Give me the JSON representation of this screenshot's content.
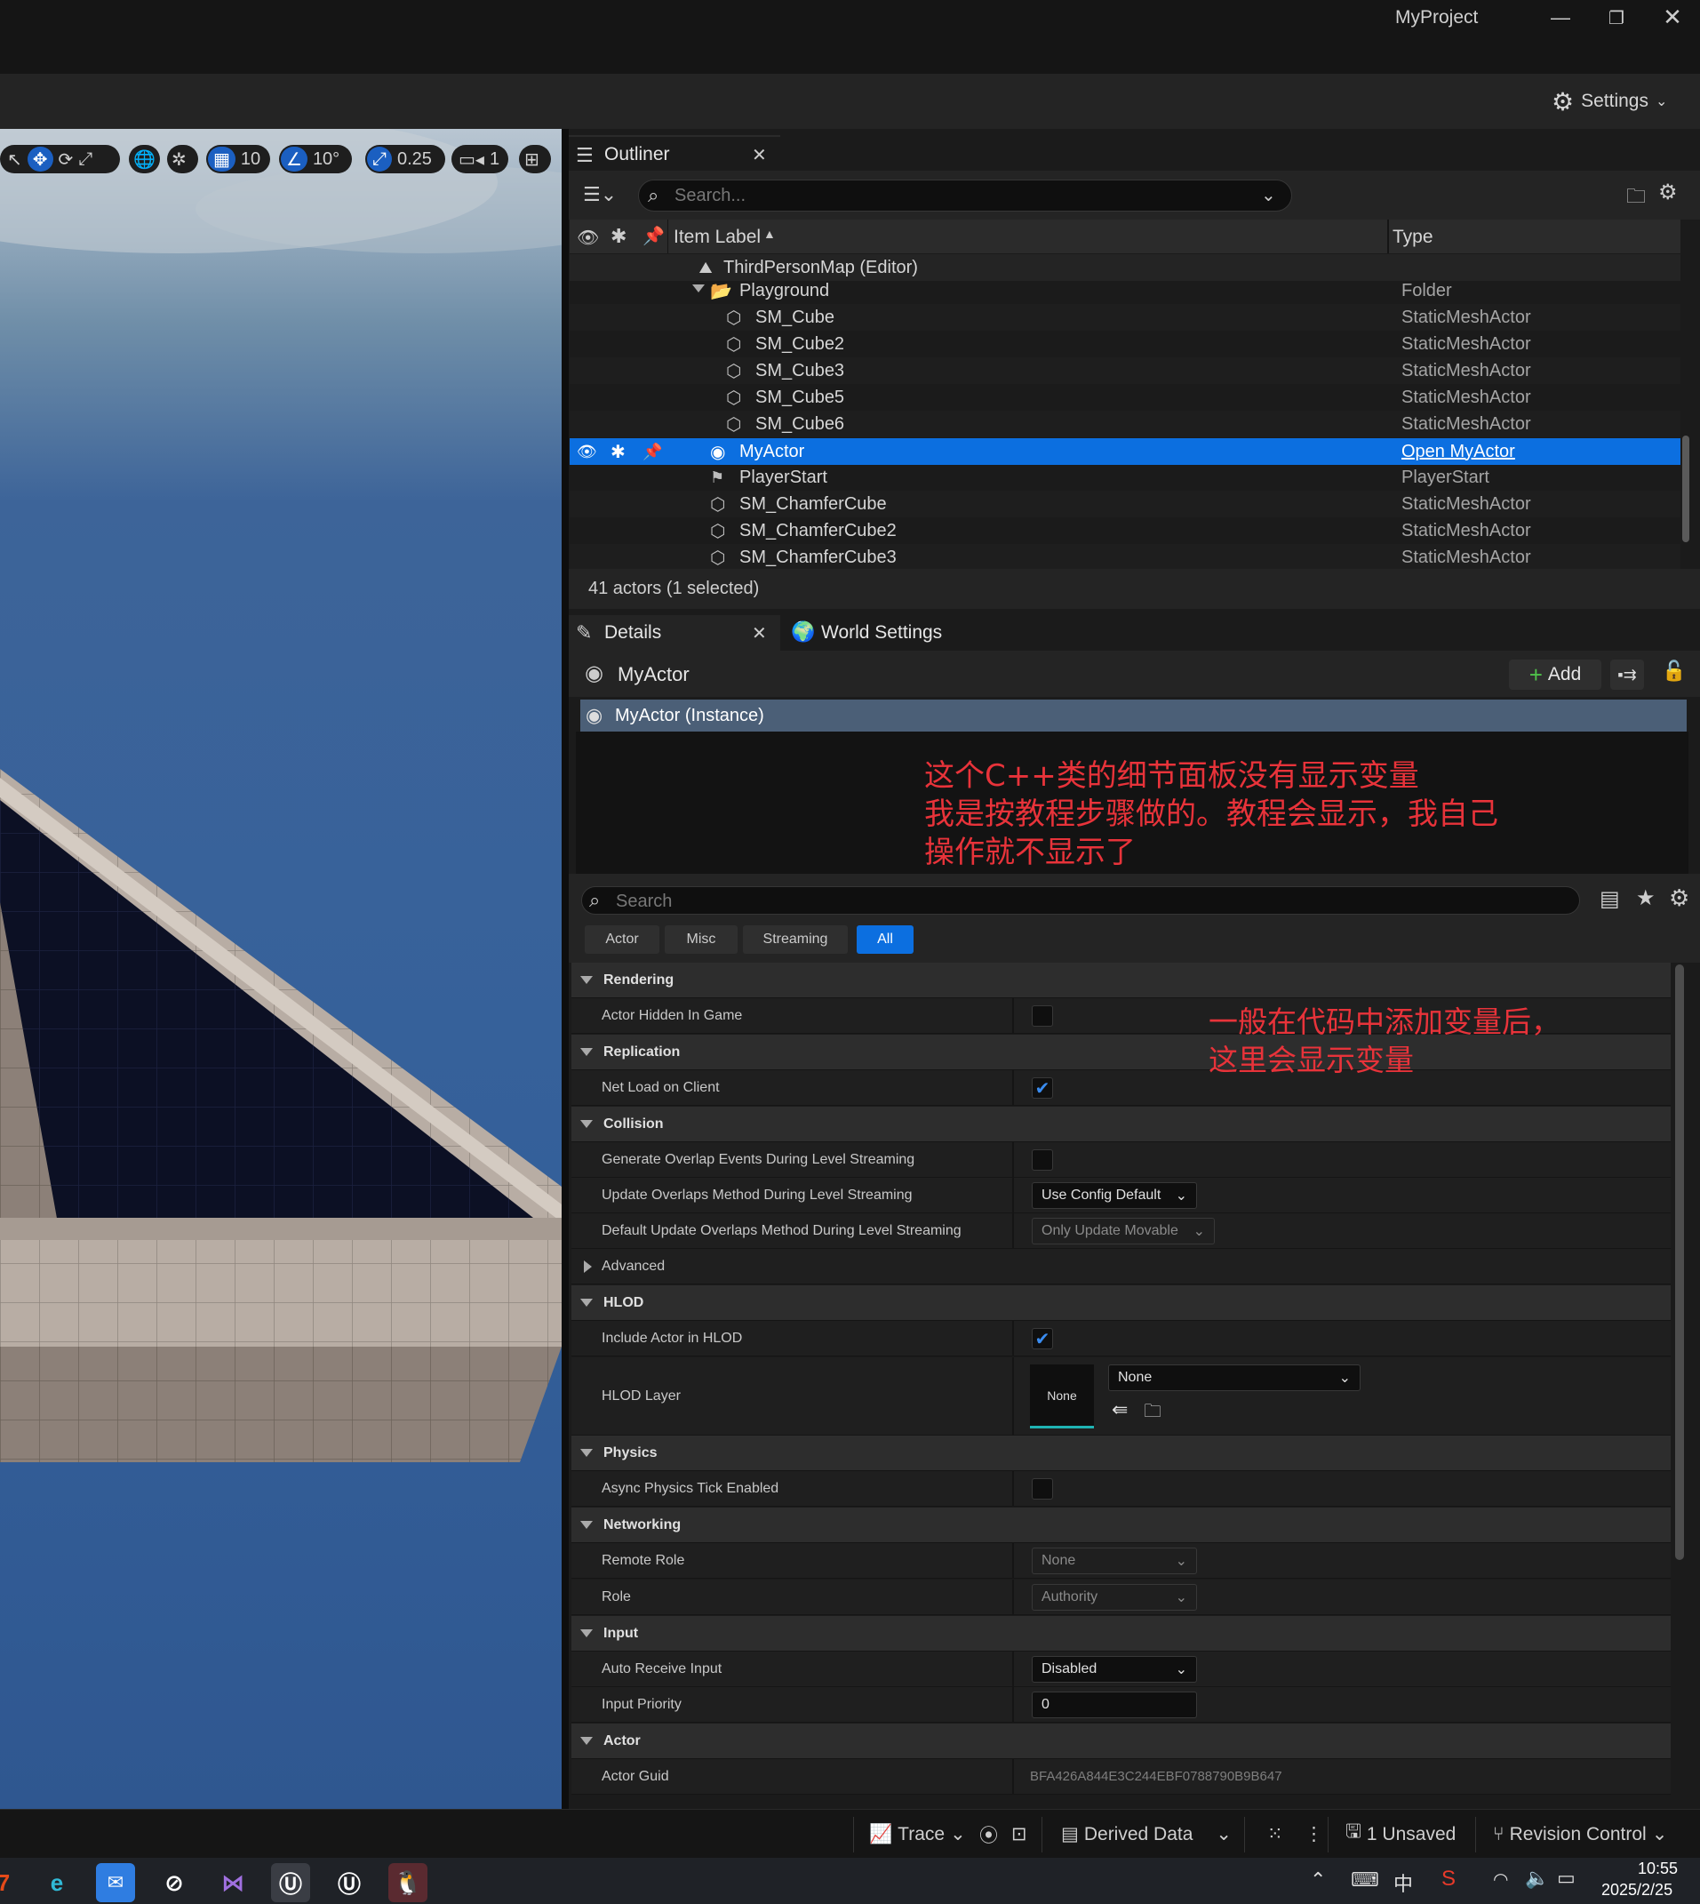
{
  "window": {
    "title": "MyProject",
    "settings_label": "Settings"
  },
  "viewport_toolbar": {
    "grid_snap": "10",
    "rot_snap": "10°",
    "scale_snap": "0.25",
    "camera_speed": "1"
  },
  "outliner": {
    "tab_label": "Outliner",
    "search_placeholder": "Search...",
    "col_label": "Item Label",
    "col_type": "Type",
    "rows": [
      {
        "label": "ThirdPersonMap (Editor)",
        "type": ""
      },
      {
        "label": "Playground",
        "type": "Folder"
      },
      {
        "label": "SM_Cube",
        "type": "StaticMeshActor"
      },
      {
        "label": "SM_Cube2",
        "type": "StaticMeshActor"
      },
      {
        "label": "SM_Cube3",
        "type": "StaticMeshActor"
      },
      {
        "label": "SM_Cube5",
        "type": "StaticMeshActor"
      },
      {
        "label": "SM_Cube6",
        "type": "StaticMeshActor"
      },
      {
        "label": "MyActor",
        "type": "Open MyActor"
      },
      {
        "label": "PlayerStart",
        "type": "PlayerStart"
      },
      {
        "label": "SM_ChamferCube",
        "type": "StaticMeshActor"
      },
      {
        "label": "SM_ChamferCube2",
        "type": "StaticMeshActor"
      },
      {
        "label": "SM_ChamferCube3",
        "type": "StaticMeshActor"
      }
    ],
    "footer": "41 actors (1 selected)"
  },
  "details": {
    "tab_label": "Details",
    "world_settings_label": "World Settings",
    "actor_name": "MyActor",
    "add_label": "Add",
    "instance_label": "MyActor (Instance)",
    "search_placeholder": "Search",
    "filters": [
      "Actor",
      "Misc",
      "Streaming",
      "All"
    ],
    "categories": {
      "rendering": "Rendering",
      "replication": "Replication",
      "collision": "Collision",
      "hlod": "HLOD",
      "physics": "Physics",
      "networking": "Networking",
      "input": "Input",
      "actor": "Actor"
    },
    "props": {
      "actor_hidden": "Actor Hidden In Game",
      "net_load": "Net Load on Client",
      "gen_overlap": "Generate Overlap Events During Level Streaming",
      "update_overlap": "Update Overlaps Method During Level Streaming",
      "update_overlap_val": "Use Config Default",
      "default_update": "Default Update Overlaps Method During Level Streaming",
      "default_update_val": "Only Update Movable",
      "advanced": "Advanced",
      "include_hlod": "Include Actor in HLOD",
      "hlod_layer": "HLOD Layer",
      "hlod_thumb": "None",
      "hlod_layer_val": "None",
      "async_physics": "Async Physics Tick Enabled",
      "remote_role": "Remote Role",
      "remote_role_val": "None",
      "role": "Role",
      "role_val": "Authority",
      "auto_receive": "Auto Receive Input",
      "auto_receive_val": "Disabled",
      "input_priority": "Input Priority",
      "input_priority_val": "0",
      "actor_guid": "Actor Guid",
      "actor_guid_val": "BFA426A844E3C244EBF0788790B9B647"
    }
  },
  "annotations": {
    "note1_line1": "这个C++类的细节面板没有显示变量",
    "note1_line2": "我是按教程步骤做的。教程会显示，我自己",
    "note1_line3": "操作就不显示了",
    "note2_line1": "一般在代码中添加变量后，",
    "note2_line2": "这里会显示变量"
  },
  "statusbar": {
    "trace": "Trace",
    "derived_data": "Derived Data",
    "unsaved": "1 Unsaved",
    "revision_control": "Revision Control"
  },
  "taskbar": {
    "time": "10:55",
    "date": "2025/2/25",
    "ime": "中"
  }
}
